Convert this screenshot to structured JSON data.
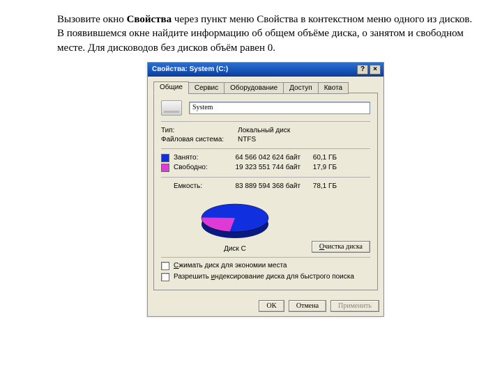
{
  "instruction": {
    "pre": "Вызовите окно ",
    "bold": "Свойства",
    "post": " через пункт меню Свойства в контекстном меню одного из дисков. В появившемся окне найдите информацию об общем объёме диска, о занятом и свободном месте. Для дисководов без дисков объём равен 0."
  },
  "window": {
    "title": "Свойства: System (C:)",
    "help_glyph": "?",
    "close_glyph": "×",
    "tabs": [
      "Общие",
      "Сервис",
      "Оборудование",
      "Доступ",
      "Квота"
    ]
  },
  "general": {
    "name_value": "System",
    "type_label": "Тип:",
    "type_value": "Локальный диск",
    "fs_label": "Файловая система:",
    "fs_value": "NTFS",
    "used_label": "Занято:",
    "used_bytes": "64 566 042 624 байт",
    "used_gb": "60,1 ГБ",
    "free_label": "Свободно:",
    "free_bytes": "19 323 551 744 байт",
    "free_gb": "17,9 ГБ",
    "cap_label": "Емкость:",
    "cap_bytes": "83 889 594 368 байт",
    "cap_gb": "78,1 ГБ",
    "cleanup_label": "Очистка диска",
    "pie_caption": "Диск C",
    "compress_label": "Сжимать диск для экономии места",
    "index_label": "Разрешить индексирование диска для быстрого поиска"
  },
  "buttons": {
    "ok": "OK",
    "cancel": "Отмена",
    "apply": "Применить"
  },
  "colors": {
    "used": "#1030e0",
    "free": "#e03ad6"
  },
  "chart_data": {
    "type": "pie",
    "title": "Диск C",
    "series": [
      {
        "name": "Занято",
        "value": 64566042624,
        "fraction": 0.77,
        "color": "#1030e0"
      },
      {
        "name": "Свободно",
        "value": 19323551744,
        "fraction": 0.23,
        "color": "#e03ad6"
      }
    ]
  }
}
